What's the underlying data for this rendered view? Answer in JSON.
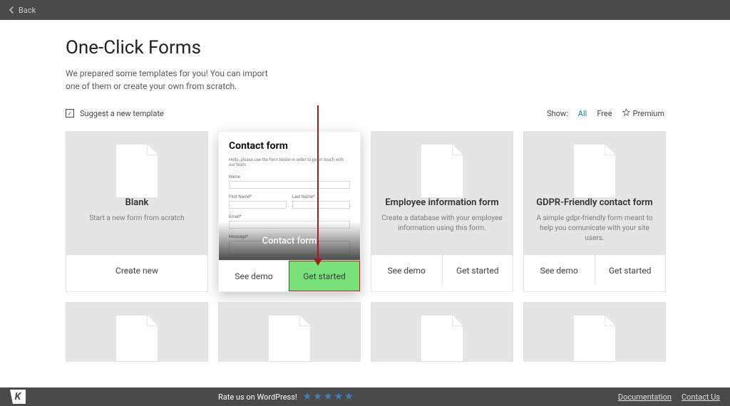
{
  "topbar": {
    "back": "Back"
  },
  "page": {
    "title": "One-Click Forms",
    "subtitle": "We prepared some templates for you! You can import one of them or create your own from scratch."
  },
  "filters": {
    "suggest": "Suggest a new template",
    "show_label": "Show:",
    "all": "All",
    "free": "Free",
    "premium": "Premium"
  },
  "cards": {
    "blank": {
      "title": "Blank",
      "desc": "Start a new form from scratch",
      "action": "Create new"
    },
    "contact": {
      "overlay_title": "Contact form",
      "mock_title": "Contact form",
      "see_demo": "See demo",
      "get_started": "Get started"
    },
    "employee": {
      "title": "Employee information form",
      "desc": "Create a database with your employee information using this form.",
      "see_demo": "See demo",
      "get_started": "Get started"
    },
    "gdpr": {
      "title": "GDPR-Friendly contact form",
      "desc": "A simple gdpr-friendly form meant to help you comunicate with your site users.",
      "see_demo": "See demo",
      "get_started": "Get started"
    }
  },
  "footer": {
    "logo": "K",
    "rate": "Rate us on WordPress!",
    "doc": "Documentation",
    "contact": "Contact Us"
  }
}
